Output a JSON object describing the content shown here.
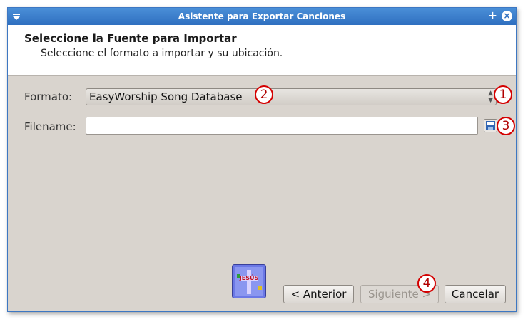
{
  "window": {
    "title": "Asistente para Exportar Canciones",
    "max_symbol": "+",
    "close_symbol": "×"
  },
  "header": {
    "title": "Seleccione la Fuente para Importar",
    "subtitle": "Seleccione el formato a importar y su ubicación."
  },
  "form": {
    "format_label": "Formato:",
    "format_value": "EasyWorship Song Database",
    "filename_label": "Filename:",
    "filename_value": ""
  },
  "buttons": {
    "back_label": "< Anterior",
    "next_label": "Siguiente >",
    "cancel_label": "Cancelar"
  },
  "markers": [
    "1",
    "2",
    "3",
    "4"
  ],
  "logo_text": "JESÚS"
}
